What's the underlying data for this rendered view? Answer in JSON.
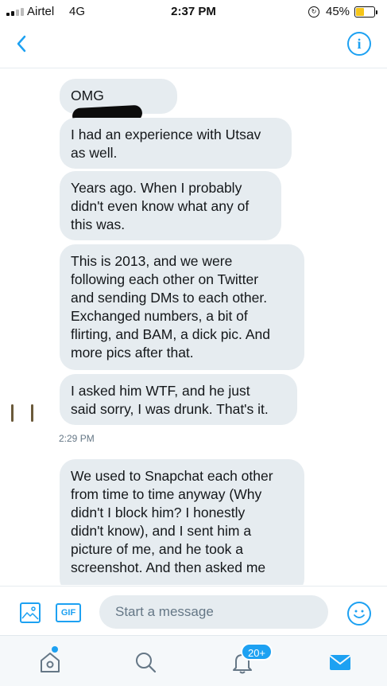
{
  "status_bar": {
    "carrier": "Airtel",
    "network": "4G",
    "time": "2:37 PM",
    "battery_percent": "45%",
    "battery_level": 0.45,
    "signal_bars": 2,
    "signal_total": 4
  },
  "header": {
    "back_icon": "chevron-left-icon",
    "info_label": "i"
  },
  "messages": [
    {
      "text": "OMG"
    },
    {
      "text": "I had an experience with Utsav\nas well."
    },
    {
      "text": "Years ago. When I probably\ndidn't even know what any of\nthis was."
    },
    {
      "text": "This is 2013, and we were\nfollowing each other on Twitter\nand sending DMs to each other.\nExchanged numbers, a bit of\nflirting, and BAM, a dick pic. And\nmore pics after that."
    },
    {
      "text": "I asked him WTF, and he just\nsaid sorry, I was drunk. That's it."
    },
    {
      "text": "We used to Snapchat each other\nfrom time to time anyway (Why\ndidn't I block him? I honestly\ndidn't know), and I sent him a\npicture of me, and he took a\nscreenshot. And then asked me"
    }
  ],
  "timestamp": "2:29 PM",
  "composer": {
    "placeholder": "Start a message",
    "gif_label": "GIF"
  },
  "tab_bar": {
    "notification_badge": "20+"
  },
  "colors": {
    "accent": "#1da1f2",
    "bubble": "#e6ecf0",
    "tab_bar_bg": "#f5f8fa"
  }
}
